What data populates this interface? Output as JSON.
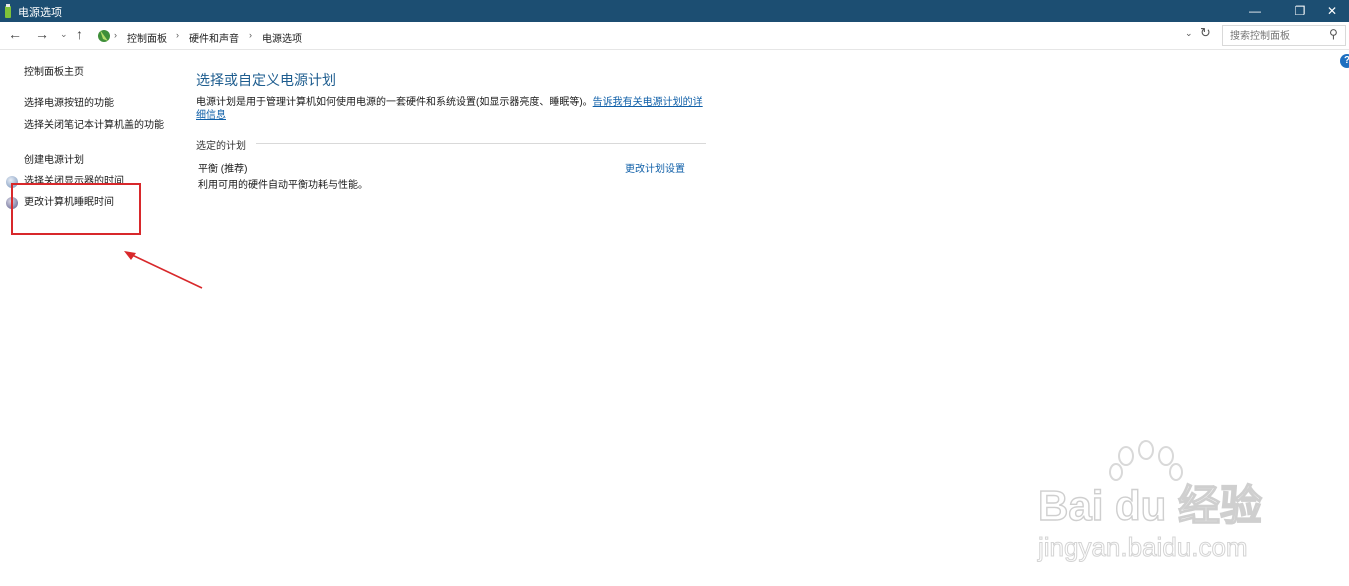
{
  "window": {
    "title": "电源选项",
    "minimize_glyph": "—",
    "maximize_glyph": "❐",
    "close_glyph": "✕"
  },
  "nav": {
    "back": "←",
    "forward": "→",
    "recent": "⌄",
    "up": "↑",
    "breadcrumbs": [
      "控制面板",
      "硬件和声音",
      "电源选项"
    ],
    "separator": "›",
    "dropdown": "⌄",
    "refresh": "↻"
  },
  "search": {
    "placeholder": "搜索控制面板",
    "icon": "⚲"
  },
  "help": {
    "glyph": "?"
  },
  "sidebar": {
    "home": "控制面板主页",
    "items": [
      "选择电源按钮的功能",
      "选择关闭笔记本计算机盖的功能",
      "创建电源计划",
      "选择关闭显示器的时间",
      "更改计算机睡眠时间"
    ]
  },
  "main": {
    "title": "选择或自定义电源计划",
    "description": "电源计划是用于管理计算机如何使用电源的一套硬件和系统设置(如显示器亮度、睡眠等)。",
    "description_link": "告诉我有关电源计划的详细信息",
    "section_label": "选定的计划",
    "plan": {
      "name": "平衡 (推荐)",
      "description": "利用可用的硬件自动平衡功耗与性能。",
      "change_link": "更改计划设置"
    }
  },
  "watermark": {
    "logo": "Bai du 经验",
    "url": "jingyan.baidu.com"
  },
  "colors": {
    "titlebar": "#1c4e72",
    "link": "#0f5fa8",
    "heading": "#1e5d8f",
    "annotation": "#d8282b"
  }
}
